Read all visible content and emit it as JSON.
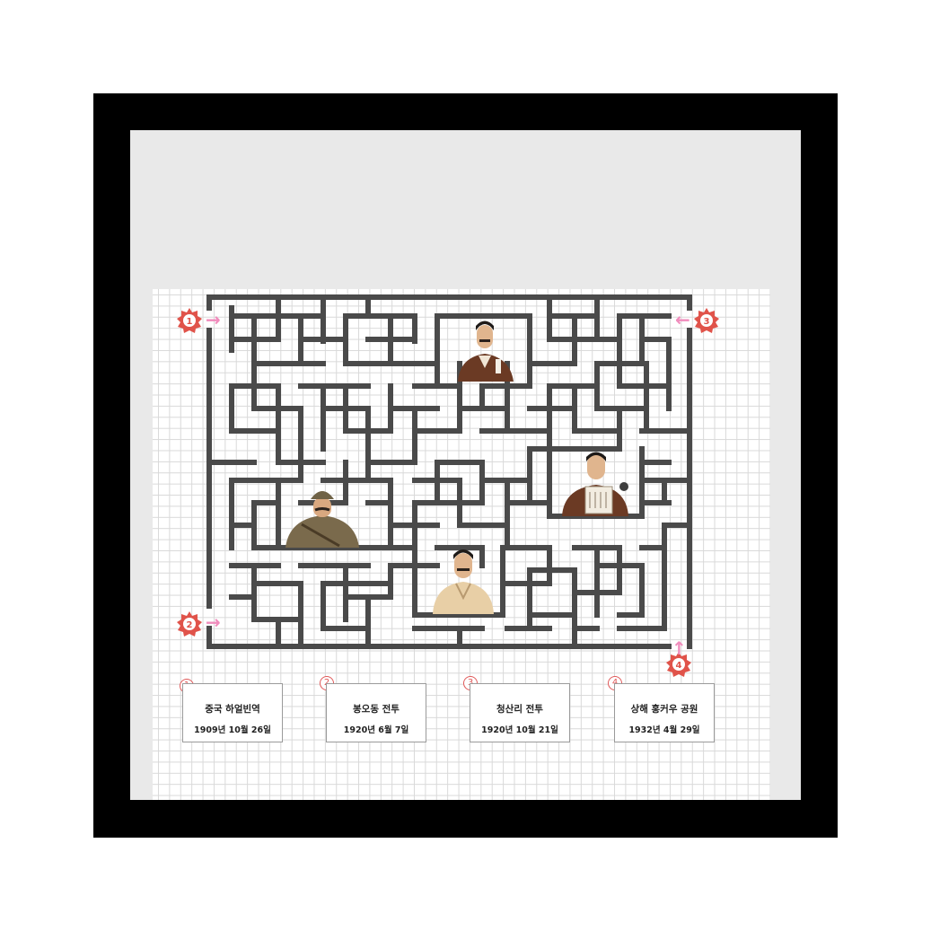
{
  "colors": {
    "wall": "#4a4a4a",
    "badge": "#e0534a",
    "arrow": "#f08cbc"
  },
  "start_markers": [
    {
      "number": "1",
      "arrow": "→"
    },
    {
      "number": "2",
      "arrow": "→"
    },
    {
      "number": "3",
      "arrow": "←"
    },
    {
      "number": "4",
      "arrow": "↑"
    }
  ],
  "cards": [
    {
      "number": "1",
      "place": "중국 하얼빈역",
      "date": "1909년 10월 26일"
    },
    {
      "number": "2",
      "place": "봉오동 전투",
      "date": "1920년 6월 7일"
    },
    {
      "number": "3",
      "place": "청산리 전투",
      "date": "1920년 10월 21일"
    },
    {
      "number": "4",
      "place": "상해 홍커우 공원",
      "date": "1932년 4월 29일"
    }
  ]
}
